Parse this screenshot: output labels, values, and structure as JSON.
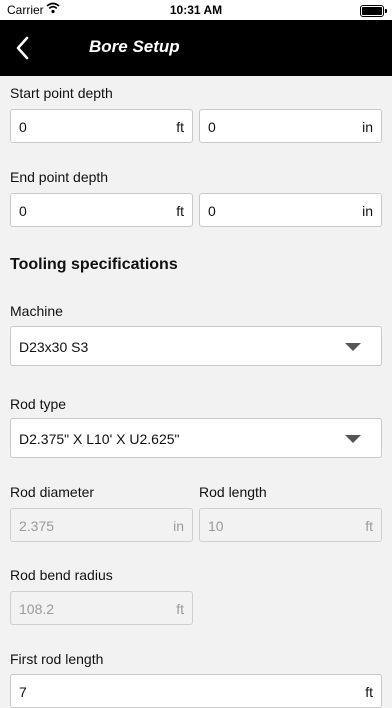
{
  "status": {
    "carrier": "Carrier",
    "time": "10:31 AM"
  },
  "header": {
    "title": "Bore Setup"
  },
  "start_depth": {
    "label": "Start point depth",
    "ft_value": "0",
    "ft_unit": "ft",
    "in_value": "0",
    "in_unit": "in"
  },
  "end_depth": {
    "label": "End point depth",
    "ft_value": "0",
    "ft_unit": "ft",
    "in_value": "0",
    "in_unit": "in"
  },
  "tooling": {
    "title": "Tooling specifications"
  },
  "machine": {
    "label": "Machine",
    "value": "D23x30 S3"
  },
  "rod_type": {
    "label": "Rod type",
    "value": "D2.375\" X L10' X U2.625\""
  },
  "rod_diameter": {
    "label": "Rod diameter",
    "value": "2.375",
    "unit": "in"
  },
  "rod_length": {
    "label": "Rod length",
    "value": "10",
    "unit": "ft"
  },
  "rod_bend_radius": {
    "label": "Rod bend radius",
    "value": "108.2",
    "unit": "ft"
  },
  "first_rod_length": {
    "label": "First rod length",
    "value": "7",
    "unit": "ft"
  }
}
